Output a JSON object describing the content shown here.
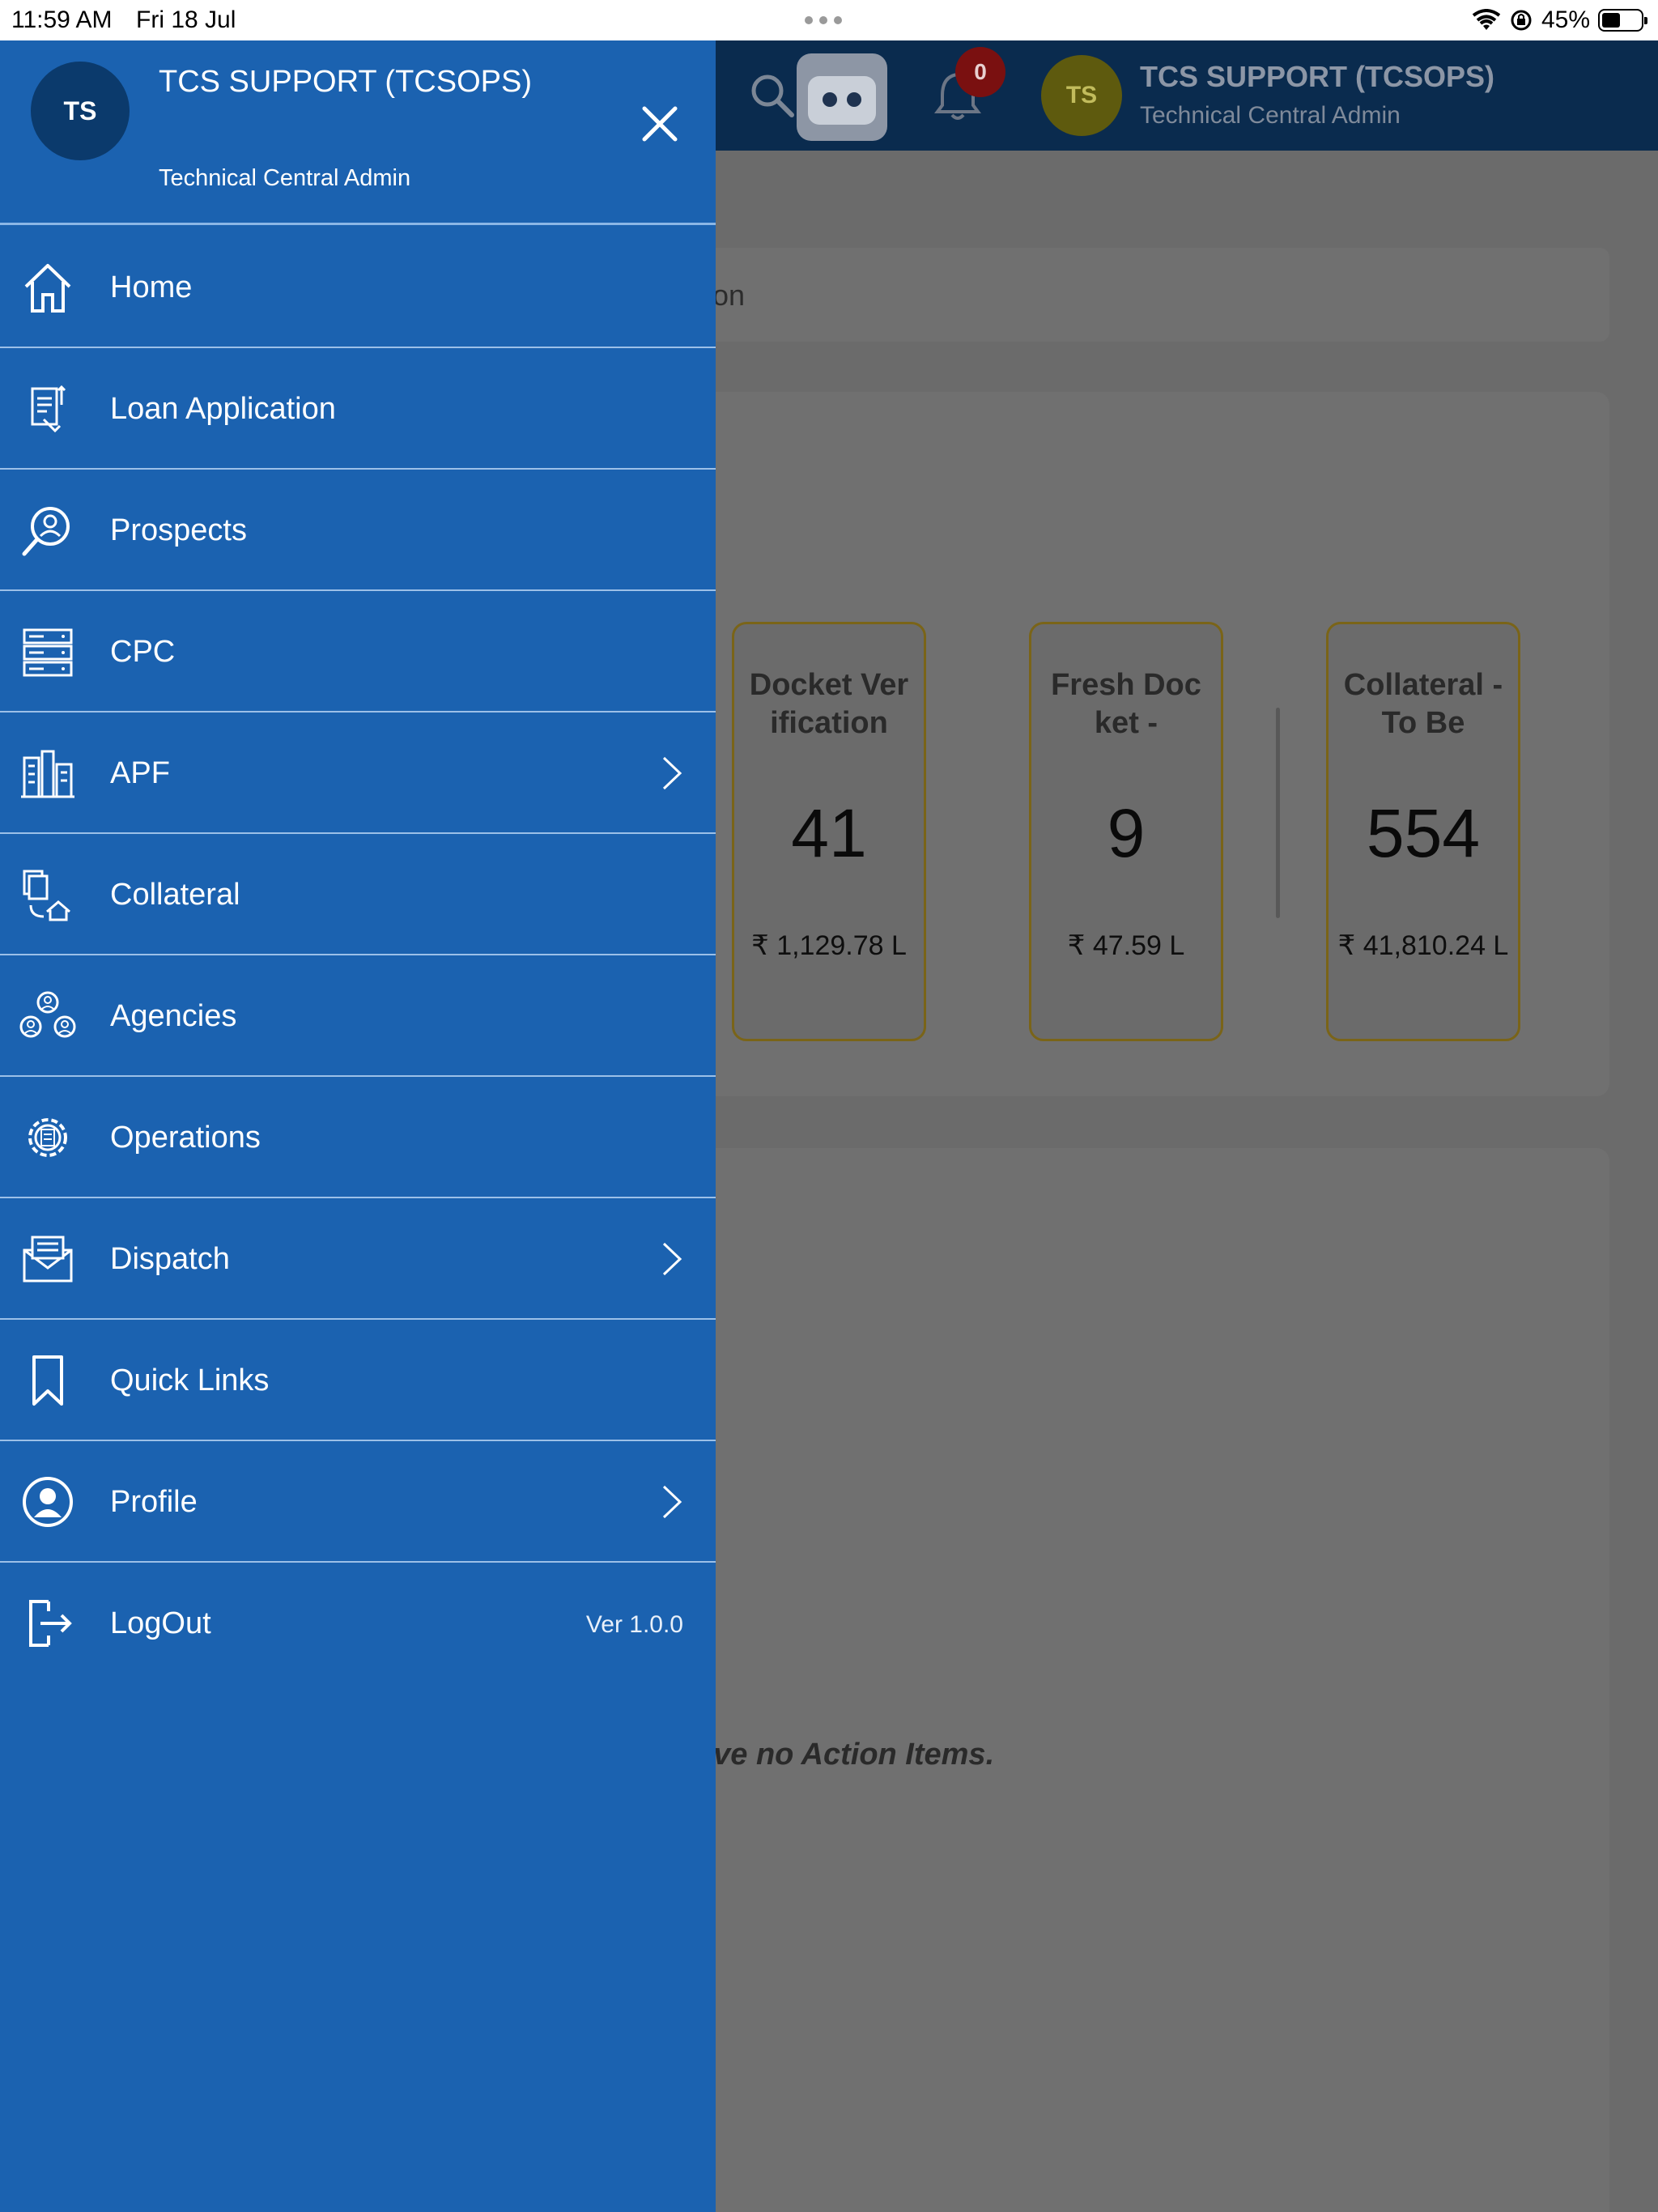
{
  "status_bar": {
    "time": "11:59 AM",
    "date": "Fri 18 Jul",
    "battery": "45%"
  },
  "header": {
    "notification_count": "0",
    "avatar_initials": "TS",
    "user_name": "TCS SUPPORT (TCSOPS)",
    "user_role": "Technical Central Admin"
  },
  "search": {
    "partial_text": "on"
  },
  "stats": [
    {
      "title": "Docket Verification",
      "count": "41",
      "amount": "₹ 1,129.78 L"
    },
    {
      "title": "Fresh Docket -",
      "count": "9",
      "amount": "₹ 47.59 L"
    },
    {
      "title": "Collateral - To Be",
      "count": "554",
      "amount": "₹ 41,810.24 L"
    }
  ],
  "actions": {
    "empty_message": "ave no Action Items."
  },
  "drawer": {
    "avatar_initials": "TS",
    "user_name": "TCS SUPPORT (TCSOPS)",
    "user_role": "Technical Central Admin",
    "menu": [
      {
        "label": "Home",
        "icon": "home-icon"
      },
      {
        "label": "Loan Application",
        "icon": "loan-document-icon"
      },
      {
        "label": "Prospects",
        "icon": "prospect-search-icon"
      },
      {
        "label": "CPC",
        "icon": "server-rack-icon"
      },
      {
        "label": "APF",
        "icon": "buildings-icon",
        "has_submenu": true
      },
      {
        "label": "Collateral",
        "icon": "property-documents-icon"
      },
      {
        "label": "Agencies",
        "icon": "people-group-icon"
      },
      {
        "label": "Operations",
        "icon": "gear-document-icon"
      },
      {
        "label": "Dispatch",
        "icon": "envelope-icon",
        "has_submenu": true
      },
      {
        "label": "Quick Links",
        "icon": "bookmark-icon"
      },
      {
        "label": "Profile",
        "icon": "user-circle-icon",
        "has_submenu": true
      },
      {
        "label": "LogOut",
        "icon": "logout-icon"
      }
    ],
    "version": "Ver 1.0.0"
  },
  "colors": {
    "drawer_bg": "#1b62b0",
    "header_bg": "#0a2b4e",
    "overlay": "#6b6b6b",
    "card_border": "#7a6418"
  }
}
